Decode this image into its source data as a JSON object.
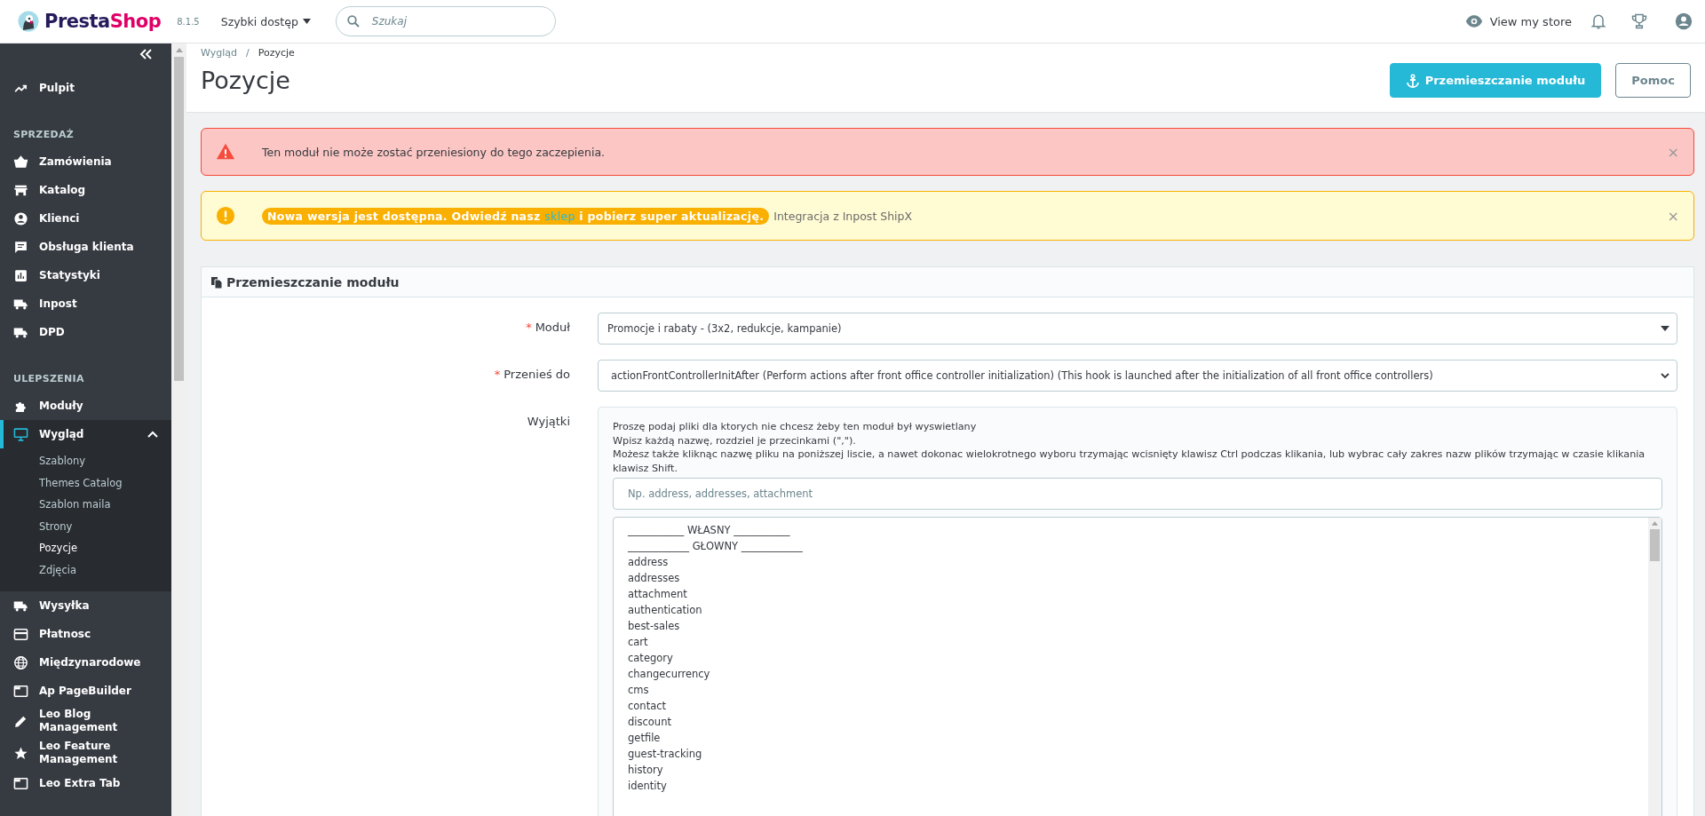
{
  "topbar": {
    "brand": {
      "part_1": "Presta",
      "part_2": "Shop"
    },
    "version": "8.1.5",
    "quick_access": "Szybki dostęp",
    "search": {
      "placeholder": "Szukaj"
    },
    "view_store": "View my store"
  },
  "sidebar": {
    "sections": [
      {
        "items": [
          {
            "label": "Pulpit",
            "selected": false
          }
        ]
      },
      {
        "heading": "SPRZEDAŻ",
        "items": [
          {
            "label": "Zamówienia",
            "selected": false
          },
          {
            "label": "Katalog",
            "selected": false
          },
          {
            "label": "Klienci",
            "selected": false
          },
          {
            "label": "Obsługa klienta",
            "selected": false
          },
          {
            "label": "Statystyki",
            "selected": false
          },
          {
            "label": "Inpost",
            "selected": false
          },
          {
            "label": "DPD",
            "selected": false
          }
        ]
      },
      {
        "heading": "ULEPSZENIA",
        "items": [
          {
            "label": "Moduły",
            "selected": false
          },
          {
            "label": "Wygląd",
            "selected": true,
            "expanded": true,
            "children": [
              {
                "label": "Szablony",
                "selected": false
              },
              {
                "label": "Themes Catalog",
                "selected": false
              },
              {
                "label": "Szablon maila",
                "selected": false
              },
              {
                "label": "Strony",
                "selected": false
              },
              {
                "label": "Pozycje",
                "selected": true
              },
              {
                "label": "Zdjęcia",
                "selected": false
              }
            ]
          },
          {
            "label": "Wysyłka",
            "selected": false
          },
          {
            "label": "Płatnosc",
            "selected": false
          },
          {
            "label": "Międzynarodowe",
            "selected": false
          },
          {
            "label": "Ap PageBuilder",
            "selected": false
          },
          {
            "label": "Leo Blog Management",
            "selected": false
          },
          {
            "label": "Leo Feature Management",
            "selected": false
          },
          {
            "label": "Leo Extra Tab",
            "selected": false
          }
        ]
      }
    ]
  },
  "header": {
    "breadcrumb": [
      "Wygląd",
      "Pozycje"
    ],
    "breadcrumb_separator": "/",
    "title": "Pozycje",
    "buttons": [
      {
        "label": "Przemieszczanie modułu",
        "kind": "primary"
      },
      {
        "label": "Pomoc",
        "kind": "outline"
      }
    ]
  },
  "alerts": [
    {
      "kind": "danger",
      "text": "Ten moduł nie może zostać przeniesiony do tego zaczepienia.",
      "close": "×"
    },
    {
      "kind": "warning",
      "badge_before": "Nowa wersja jest dostępna. Odwiedź nasz",
      "link": "sklep",
      "badge_after": "i pobierz super aktualizację.",
      "text": "Integracja z Inpost ShipX",
      "close": "×"
    }
  ],
  "panel": {
    "title": "Przemieszczanie modułu",
    "fields": [
      {
        "kind": "select2",
        "label": "Moduł",
        "required_mark": "*",
        "value": "Promocje i rabaty - (3x2, redukcje, kampanie)"
      },
      {
        "kind": "select",
        "label": "Przenieś do",
        "required_mark": "*",
        "value": "actionFrontControllerInitAfter (Perform actions after front office controller initialization) (This hook is launched after the initialization of all front office controllers)"
      },
      {
        "kind": "exceptions",
        "label": "Wyjątki",
        "help": [
          "Proszę podaj pliki dla ktorych nie chcesz żeby ten moduł był wyswietlany",
          "Wpisz każdą nazwę, rozdziel je przecinkami (\",\").",
          "Możesz także kliknąc nazwę pliku na poniższej liscie, a nawet dokonac wielokrotnego wyboru trzymając wcisnięty klawisz Ctrl podczas klikania, lub wybrac cały zakres nazw plików trzymając w czasie klikania klawisz Shift."
        ],
        "placeholder": "Np. address, addresses, attachment",
        "options": [
          "___________ WŁASNY ___________",
          "____________ GŁOWNY ____________",
          "address",
          "addresses",
          "attachment",
          "authentication",
          "best-sales",
          "cart",
          "category",
          "changecurrency",
          "cms",
          "contact",
          "discount",
          "getfile",
          "guest-tracking",
          "history",
          "identity"
        ]
      }
    ]
  }
}
